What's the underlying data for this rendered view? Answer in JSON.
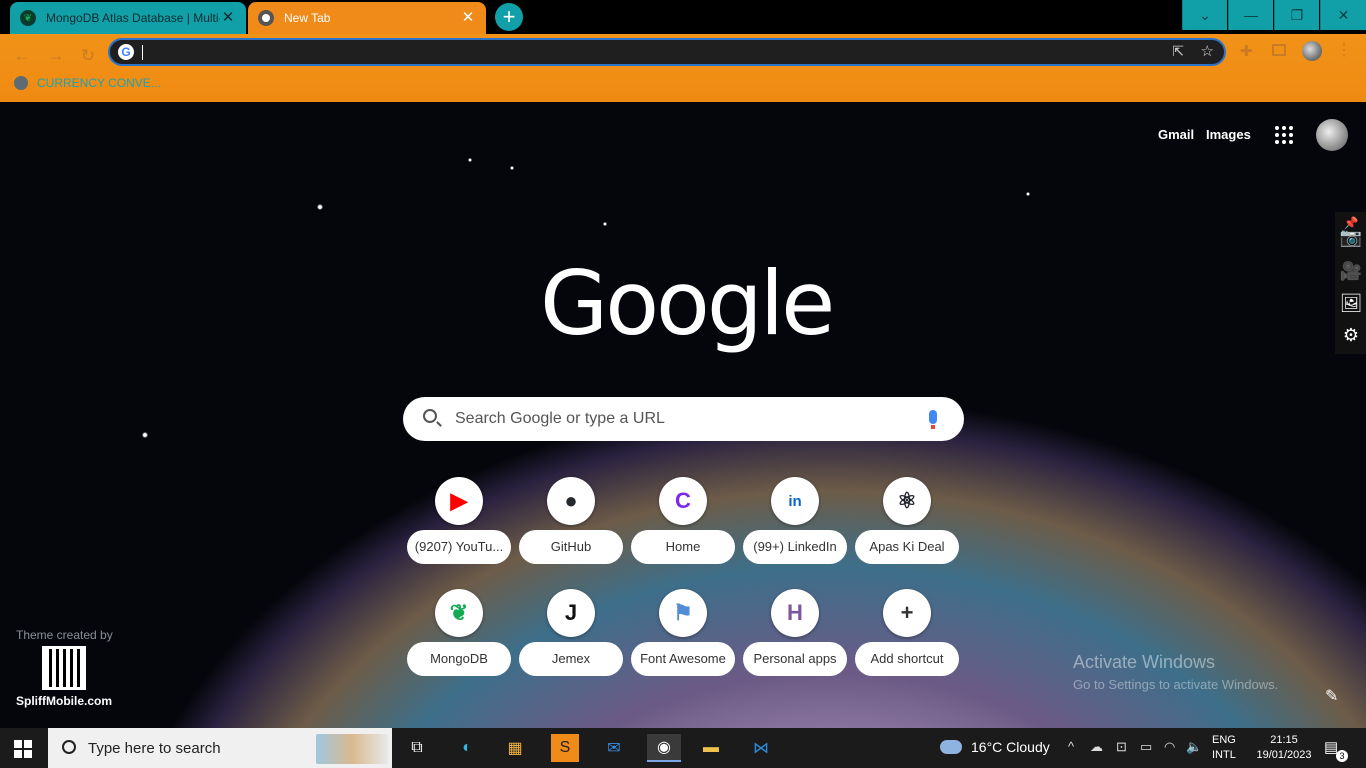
{
  "tabs": [
    {
      "title": "MongoDB Atlas Database | Multi-",
      "close": "✕"
    },
    {
      "title": "New Tab",
      "close": "✕"
    }
  ],
  "new_tab_button": "+",
  "window_controls": {
    "chevron": "⌄",
    "minimize": "—",
    "restore": "❐",
    "close": "✕"
  },
  "bookmarks": [
    {
      "label": "CURRENCY CONVE..."
    }
  ],
  "omnibox": {
    "value": ""
  },
  "ntp": {
    "header_links": {
      "gmail": "Gmail",
      "images": "Images"
    },
    "logo": "Google",
    "search_placeholder": "Search Google or type a URL",
    "shortcuts": [
      {
        "label": "(9207) YouTu...",
        "icon": "youtube-icon",
        "glyph": "▶",
        "color": "#ff0000"
      },
      {
        "label": "GitHub",
        "icon": "github-icon",
        "glyph": "●",
        "color": "#24292e"
      },
      {
        "label": "Home",
        "icon": "canva-icon",
        "glyph": "C",
        "color": "#7d2ae8"
      },
      {
        "label": "(99+) LinkedIn",
        "icon": "linkedin-icon",
        "glyph": "in",
        "color": "#0a66c2"
      },
      {
        "label": "Apas Ki Deal",
        "icon": "react-icon",
        "glyph": "⚛",
        "color": "#20232a"
      },
      {
        "label": "MongoDB",
        "icon": "mongodb-icon",
        "glyph": "❦",
        "color": "#13aa52"
      },
      {
        "label": "Jemex",
        "icon": "jemex-icon",
        "glyph": "J",
        "color": "#111111"
      },
      {
        "label": "Font Awesome",
        "icon": "flag-icon",
        "glyph": "⚑",
        "color": "#528dd7"
      },
      {
        "label": "Personal apps",
        "icon": "heroku-icon",
        "glyph": "H",
        "color": "#79589f"
      },
      {
        "label": "Add shortcut",
        "icon": "plus-icon",
        "glyph": "+",
        "color": "#333333"
      }
    ],
    "theme_credit": "Theme created by",
    "theme_site": "SpliffMobile.com",
    "activate_title": "Activate Windows",
    "activate_sub": "Go to Settings to activate Windows."
  },
  "taskbar": {
    "search_placeholder": "Type here to search",
    "weather": "16°C  Cloudy",
    "lang_1": "ENG",
    "lang_2": "INTL",
    "time": "21:15",
    "date": "19/01/2023",
    "notification_count": "3"
  }
}
